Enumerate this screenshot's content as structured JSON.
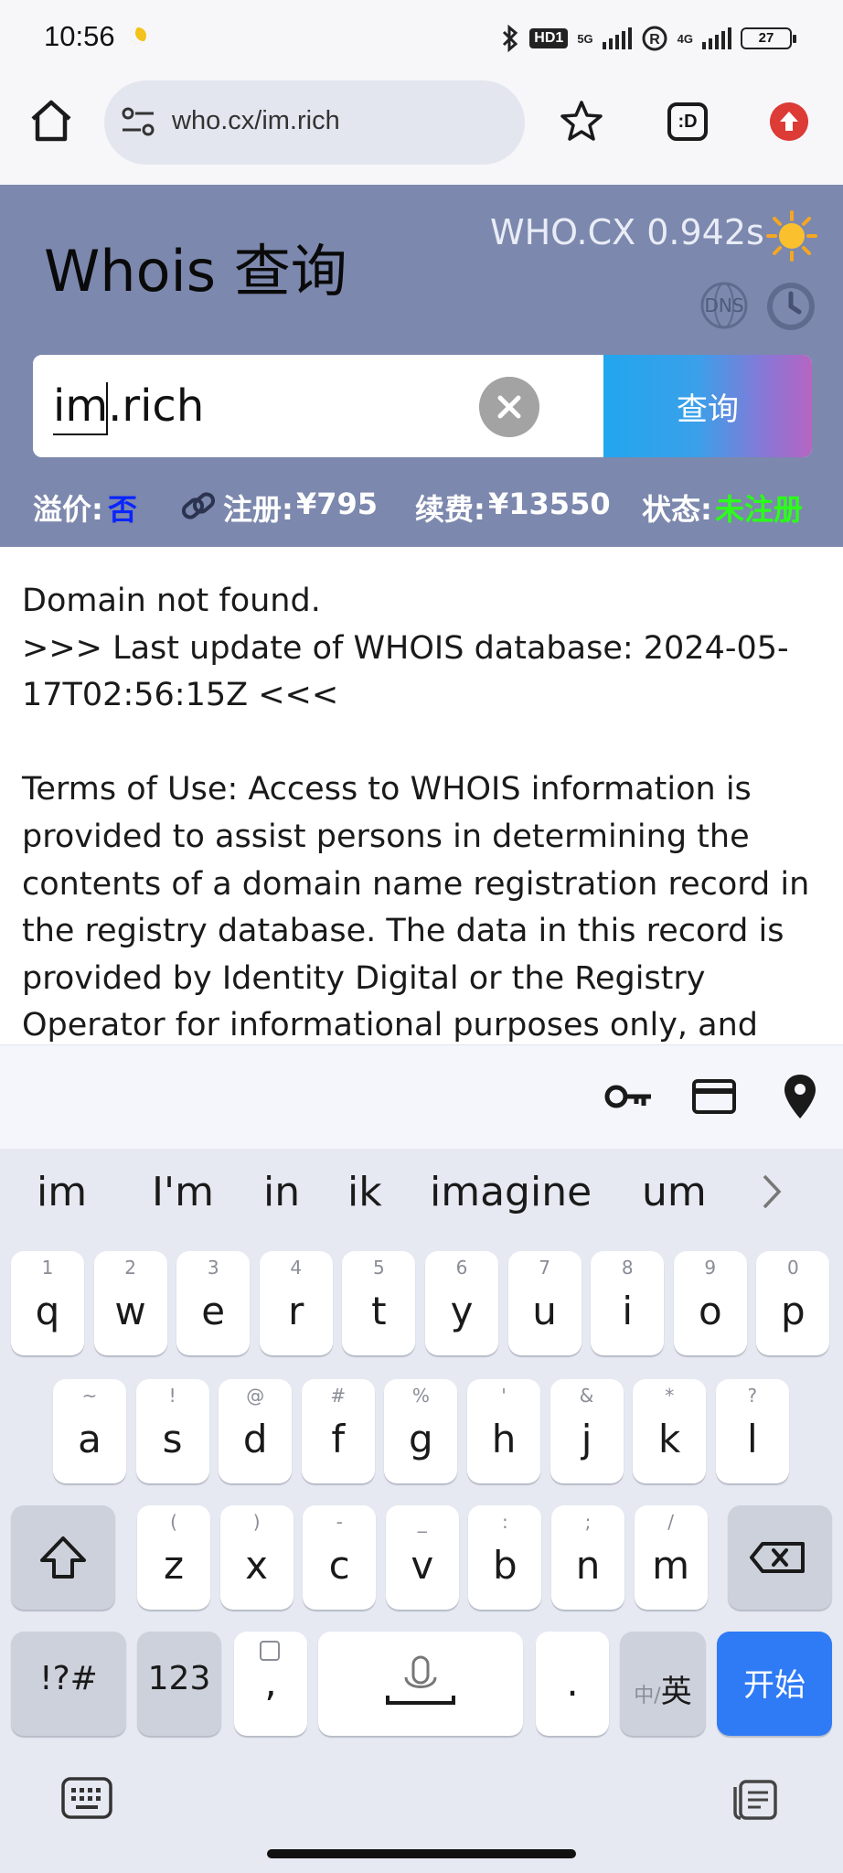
{
  "status_bar": {
    "time": "10:56",
    "hd": "HD1",
    "net1": "5G",
    "net2": "4G",
    "battery": "27"
  },
  "browser": {
    "url": "who.cx/im.rich"
  },
  "whois": {
    "title": "Whois 查询",
    "brand": "WHO.CX 0.942s",
    "dns_label": "DNS",
    "search_value": "im.rich",
    "search_button": "查询",
    "info": {
      "premium_label": "溢价:",
      "premium_value": "否",
      "register_label": "注册:",
      "register_value": "¥795",
      "renew_label": "续费:",
      "renew_value": "¥13550",
      "status_label": "状态:",
      "status_value": "未注册"
    },
    "colors": {
      "header_bg": "#7c88ad",
      "premium_value": "#0a25ff",
      "status_value": "#2bff1a"
    }
  },
  "result": {
    "line1": "Domain not found.",
    "line2": ">>> Last update of WHOIS database: 2024-05-17T02:56:15Z <<<",
    "terms": "Terms of Use: Access to WHOIS information is provided to assist persons in determining the contents of a domain name registration record in the registry database. The data in this record is provided by Identity Digital or the Registry Operator for informational purposes only, and"
  },
  "keyboard": {
    "suggestions": [
      "im",
      "I'm",
      "in",
      "ik",
      "imagine",
      "um"
    ],
    "row1": [
      {
        "k": "q",
        "s": "1"
      },
      {
        "k": "w",
        "s": "2"
      },
      {
        "k": "e",
        "s": "3"
      },
      {
        "k": "r",
        "s": "4"
      },
      {
        "k": "t",
        "s": "5"
      },
      {
        "k": "y",
        "s": "6"
      },
      {
        "k": "u",
        "s": "7"
      },
      {
        "k": "i",
        "s": "8"
      },
      {
        "k": "o",
        "s": "9"
      },
      {
        "k": "p",
        "s": "0"
      }
    ],
    "row2": [
      {
        "k": "a",
        "s": "~"
      },
      {
        "k": "s",
        "s": "!"
      },
      {
        "k": "d",
        "s": "@"
      },
      {
        "k": "f",
        "s": "#"
      },
      {
        "k": "g",
        "s": "%"
      },
      {
        "k": "h",
        "s": "'"
      },
      {
        "k": "j",
        "s": "&"
      },
      {
        "k": "k",
        "s": "*"
      },
      {
        "k": "l",
        "s": "?"
      }
    ],
    "row3": [
      {
        "k": "z",
        "s": "("
      },
      {
        "k": "x",
        "s": ")"
      },
      {
        "k": "c",
        "s": "-"
      },
      {
        "k": "v",
        "s": "_"
      },
      {
        "k": "b",
        "s": ":"
      },
      {
        "k": "n",
        "s": ";"
      },
      {
        "k": "m",
        "s": "/"
      }
    ],
    "symbols_key": "!?#",
    "numbers_key": "123",
    "comma_key": ",",
    "period_key": ".",
    "lang_key_dim": "中/",
    "lang_key": "英",
    "enter_key": "开始"
  }
}
